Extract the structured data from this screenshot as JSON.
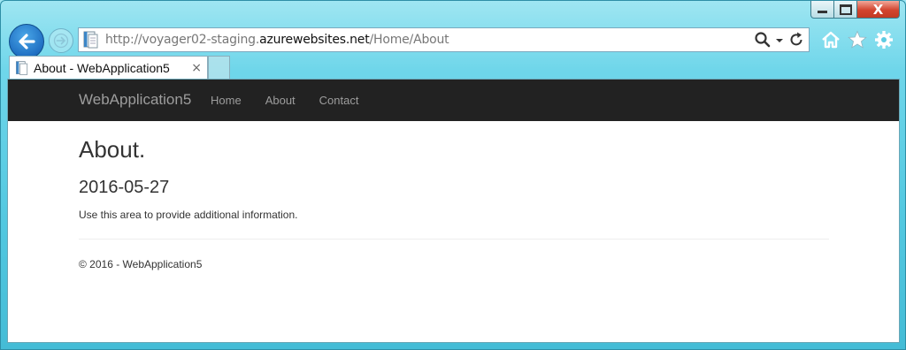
{
  "browser": {
    "url_prefix": "http://voyager02-staging.",
    "url_domain": "azurewebsites.net",
    "url_path": "/Home/About",
    "tab_title": "About - WebApplication5",
    "tab_close": "×",
    "close_glyph": "X"
  },
  "site": {
    "brand": "WebApplication5",
    "nav": [
      "Home",
      "About",
      "Contact"
    ],
    "nav_color": "#9d9d9d",
    "navbar_bg": "#222222"
  },
  "page": {
    "heading": "About.",
    "subheading": "2016-05-27",
    "info": "Use this area to provide additional information.",
    "footer": "© 2016 - WebApplication5"
  }
}
